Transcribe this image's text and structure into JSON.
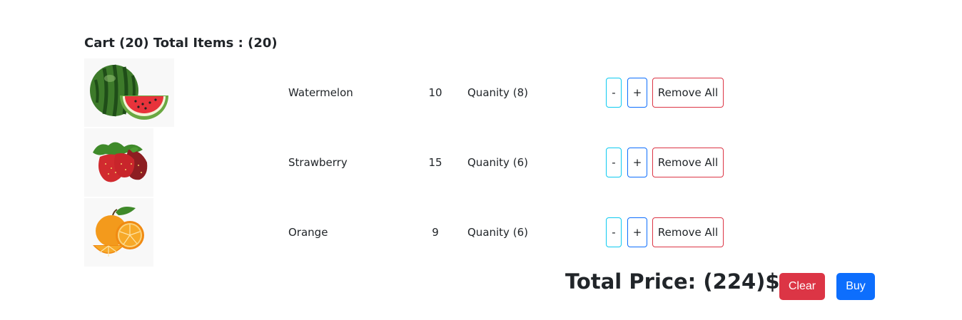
{
  "cart": {
    "label": "Cart",
    "count": "(20)",
    "total_items_label": "Total Items :",
    "total_items": "(20)"
  },
  "items": [
    {
      "name": "Watermelon",
      "price": "10",
      "quantity_label": "Quanity",
      "quantity": "(8)",
      "minus": "-",
      "plus": "+",
      "remove": "Remove All",
      "image_icon": "watermelon-image"
    },
    {
      "name": "Strawberry",
      "price": "15",
      "quantity_label": "Quanity",
      "quantity": "(6)",
      "minus": "-",
      "plus": "+",
      "remove": "Remove All",
      "image_icon": "strawberry-image"
    },
    {
      "name": "Orange",
      "price": "9",
      "quantity_label": "Quanity",
      "quantity": "(6)",
      "minus": "-",
      "plus": "+",
      "remove": "Remove All",
      "image_icon": "orange-image"
    }
  ],
  "footer": {
    "total_label": "Total Price:",
    "total_value": "(224)$",
    "clear_label": "Clear",
    "buy_label": "Buy"
  },
  "colors": {
    "minus_border": "#0dcaf0",
    "plus_border": "#0d6efd",
    "remove_border": "#dc3545",
    "clear_bg": "#dc3545",
    "buy_bg": "#0d6efd"
  }
}
